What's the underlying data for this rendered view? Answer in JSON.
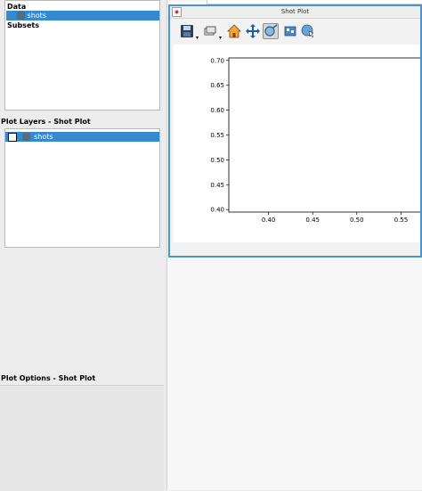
{
  "data_panel": {
    "heading": "Data",
    "items": [
      {
        "label": "shots"
      }
    ],
    "subsets_heading": "Subsets"
  },
  "layers_panel": {
    "heading": "Plot Layers - Shot Plot",
    "items": [
      {
        "label": "shots",
        "checked": true
      }
    ]
  },
  "options_panel": {
    "heading": "Plot Options - Shot Plot"
  },
  "plot_window": {
    "title": "Shot Plot",
    "toolbar": [
      {
        "name": "save-icon"
      },
      {
        "name": "subset-mode-icon"
      },
      {
        "name": "home-icon"
      },
      {
        "name": "pan-icon"
      },
      {
        "name": "zoom-icon"
      },
      {
        "name": "export-icon"
      },
      {
        "name": "select-icon"
      }
    ]
  },
  "colors": {
    "selection": "#3489d1",
    "window_border": "#4c92d6"
  },
  "chart_data": {
    "type": "scatter",
    "title": "",
    "xlabel": "",
    "ylabel": "",
    "x_ticks": [
      "0.40",
      "0.45",
      "0.50",
      "0.55"
    ],
    "y_ticks": [
      "0.40",
      "0.45",
      "0.50",
      "0.55",
      "0.60",
      "0.65",
      "0.70"
    ],
    "x_ticks_values": [
      0.4,
      0.45,
      0.5,
      0.55
    ],
    "y_ticks_values": [
      0.4,
      0.45,
      0.5,
      0.55,
      0.6,
      0.65,
      0.7
    ],
    "xlim": [
      0.355,
      0.595
    ],
    "ylim": [
      0.395,
      0.705
    ],
    "series": []
  }
}
